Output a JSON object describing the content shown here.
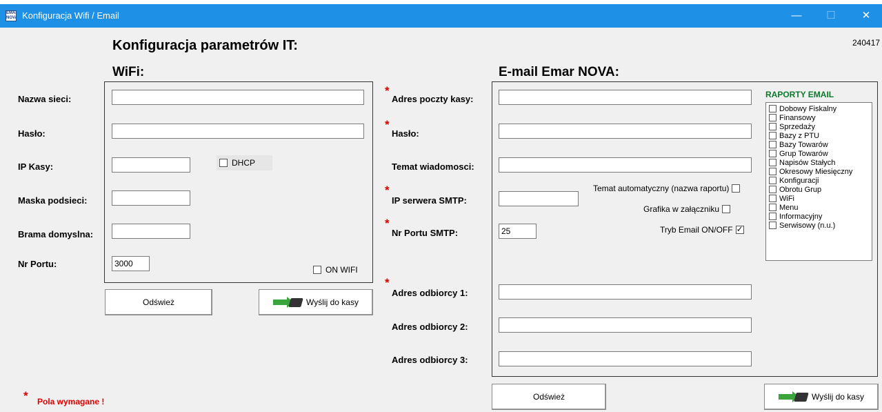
{
  "window": {
    "title": "Konfiguracja Wifi / Email",
    "app_icon_text": "EMAR NOVA",
    "minimize": "—",
    "maximize": "☐",
    "close": "✕"
  },
  "header": {
    "title": "Konfiguracja parametrów IT:",
    "version": "240417"
  },
  "wifi": {
    "section_title": "WiFi:",
    "labels": {
      "network_name": "Nazwa sieci:",
      "password": "Hasło:",
      "ip": "IP Kasy:",
      "mask": "Maska podsieci:",
      "gateway": "Brama domyslna:",
      "port": "Nr Portu:"
    },
    "values": {
      "network_name": "",
      "password": "",
      "ip": "",
      "mask": "",
      "gateway": "",
      "port": "3000"
    },
    "dhcp_label": "DHCP",
    "dhcp_checked": false,
    "on_wifi_label": "ON WIFI",
    "on_wifi_checked": false,
    "refresh_label": "Odśwież",
    "send_label": "Wyślij do kasy"
  },
  "email": {
    "section_title": "E-mail Emar NOVA:",
    "required_mark": "*",
    "labels": {
      "address": "Adres poczty kasy:",
      "password": "Hasło:",
      "subject": "Temat wiadomosci:",
      "smtp_ip": "IP serwera SMTP:",
      "smtp_port": "Nr Portu SMTP:",
      "recipient1": "Adres odbiorcy 1:",
      "recipient2": "Adres odbiorcy 2:",
      "recipient3": "Adres odbiorcy 3:"
    },
    "values": {
      "address": "",
      "password": "",
      "subject": "",
      "smtp_ip": "",
      "smtp_port": "25",
      "recipient1": "",
      "recipient2": "",
      "recipient3": ""
    },
    "auto_subject_label": "Temat automatyczny (nazwa raportu)",
    "auto_subject_checked": false,
    "attachment_label": "Grafika w załączniku",
    "attachment_checked": false,
    "email_toggle_label": "Tryb Email ON/OFF",
    "email_toggle_checked": true,
    "refresh_label": "Odśwież",
    "send_label": "Wyślij do kasy"
  },
  "reports": {
    "title": "RAPORTY EMAIL",
    "items": [
      "Dobowy Fiskalny",
      "Finansowy",
      "Sprzedaży",
      "Bazy z PTU",
      "Bazy Towarów",
      "Grup Towarów",
      "Napisów Stałych",
      "Okresowy Miesięczny",
      "Konfiguracji",
      "Obrotu Grup",
      "WiFi",
      "Menu",
      "Informacyjny",
      "Serwisowy (n.u.)"
    ]
  },
  "footer": {
    "required_mark": "*",
    "required_note": "Pola wymagane !"
  },
  "colors": {
    "titlebar": "#1e90e6",
    "required": "#e00000",
    "report_title": "#0a7a2a"
  }
}
